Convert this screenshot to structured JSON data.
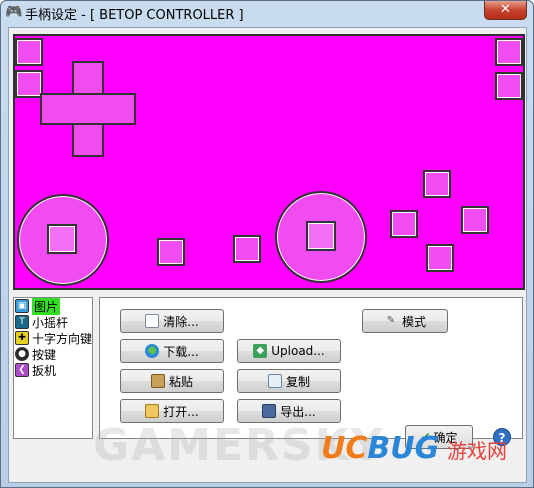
{
  "window": {
    "title": "手柄设定 - [ BETOP CONTROLLER ]",
    "title_icon": "gamepad-icon",
    "close_label": "✕"
  },
  "colors": {
    "canvas": "#ff00ff",
    "pad": "#f04cf0",
    "selection": "#33dd22"
  },
  "element_list": {
    "items": [
      {
        "label": "图片",
        "icon": "picture-icon",
        "selected": true
      },
      {
        "label": "小摇杆",
        "icon": "joystick-icon",
        "selected": false
      },
      {
        "label": "十字方向键",
        "icon": "dpad-icon",
        "selected": false
      },
      {
        "label": "按键",
        "icon": "button-icon",
        "selected": false
      },
      {
        "label": "扳机",
        "icon": "trigger-icon",
        "selected": false
      }
    ]
  },
  "buttons": {
    "clear": "清除...",
    "mode": "模式",
    "download": "下载...",
    "upload": "Upload...",
    "paste": "粘贴",
    "copy": "复制",
    "open": "打开...",
    "export": "导出..."
  },
  "footer": {
    "ok": "确定",
    "help": "?"
  },
  "watermarks": {
    "center": "GAMERSKY",
    "brand_u": "UC",
    "brand_b": "BUG",
    "cn": "游戏网"
  }
}
